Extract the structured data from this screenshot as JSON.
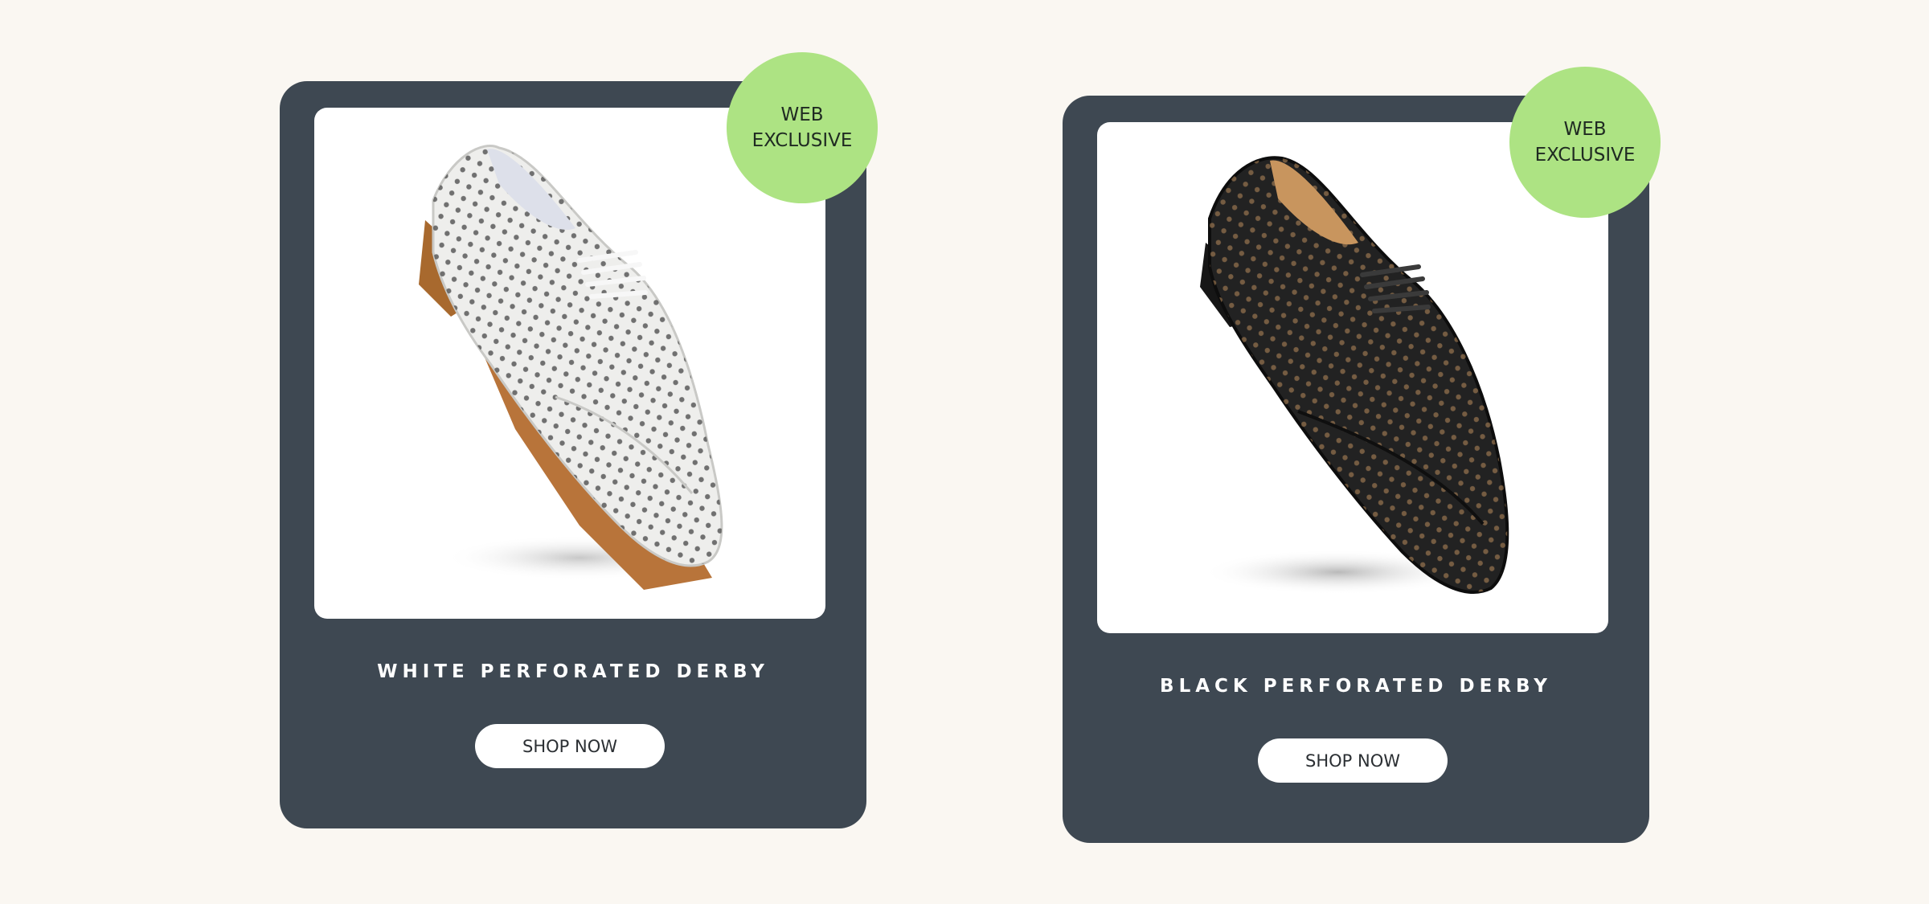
{
  "products": [
    {
      "name": "WHITE PERFORATED DERBY",
      "badge_line1": "WEB",
      "badge_line2": "EXCLUSIVE",
      "cta": "SHOP NOW",
      "shoe_color": "white"
    },
    {
      "name": "BLACK PERFORATED DERBY",
      "badge_line1": "WEB",
      "badge_line2": "EXCLUSIVE",
      "cta": "SHOP NOW",
      "shoe_color": "black"
    }
  ],
  "colors": {
    "page_background": "#faf7f2",
    "card_background": "#3e4852",
    "badge_background": "#ade383",
    "button_background": "#ffffff"
  }
}
